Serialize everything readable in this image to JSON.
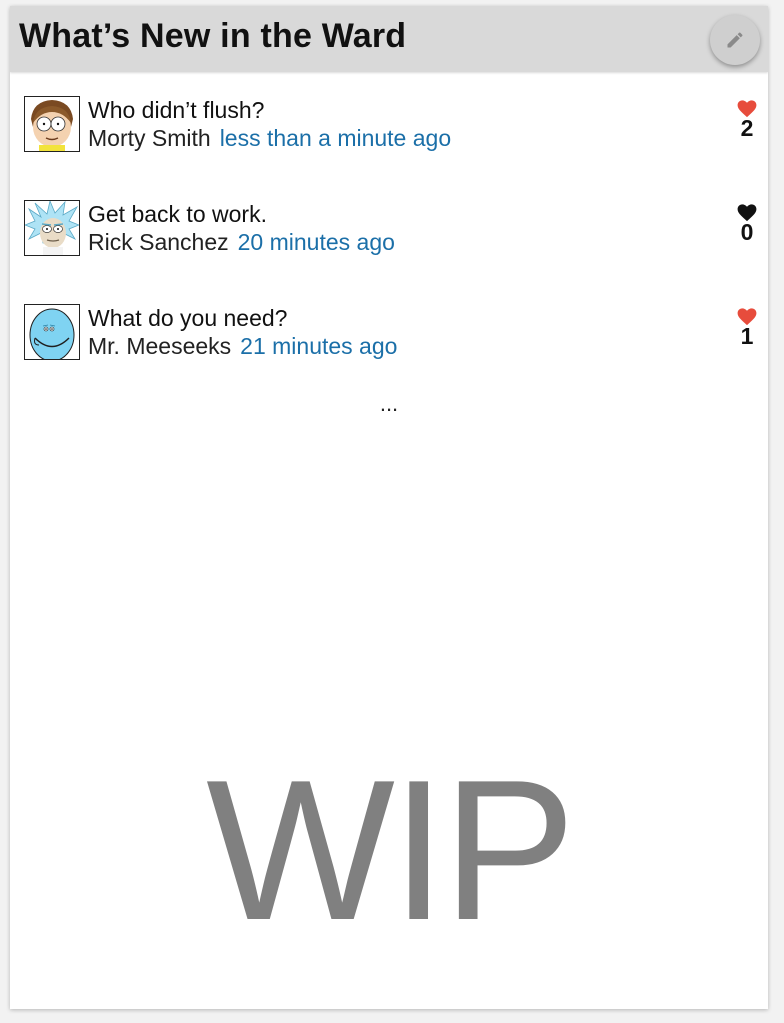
{
  "header": {
    "title": "What’s New in the Ward",
    "edit_icon": "pencil-icon"
  },
  "posts": [
    {
      "title": "Who didn’t flush?",
      "author": "Morty Smith",
      "time": "less than a minute ago",
      "likes": "2",
      "liked": true,
      "avatar_icon": "morty-avatar"
    },
    {
      "title": "Get back to work.",
      "author": "Rick Sanchez",
      "time": "20 minutes ago",
      "likes": "0",
      "liked": false,
      "avatar_icon": "rick-avatar"
    },
    {
      "title": "What do you need?",
      "author": "Mr. Meeseeks",
      "time": "21 minutes ago",
      "likes": "1",
      "liked": true,
      "avatar_icon": "meeseeks-avatar"
    }
  ],
  "more_label": "...",
  "watermark": "WIP",
  "colors": {
    "header_bg": "#d9d9d9",
    "timestamp": "#1b6fa8",
    "heart_liked": "#e74c3c",
    "heart_unliked": "#111111",
    "watermark": "#808080"
  }
}
